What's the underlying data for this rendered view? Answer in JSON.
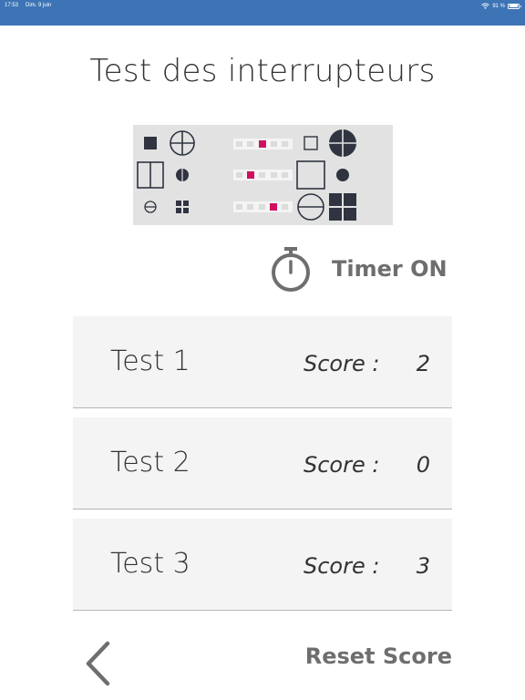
{
  "status_bar": {
    "time": "17:53",
    "date": "Dim. 9 juin",
    "battery": "91 %",
    "wifi_icon": "wifi-icon",
    "background_color": "#3d74b5"
  },
  "page": {
    "title": "Test des interrupteurs"
  },
  "illustration": {
    "description_icon": "switch-test-illustration",
    "background_color": "#e2e2e2",
    "accent_color": "#d0105f"
  },
  "timer": {
    "icon": "stopwatch-icon",
    "label": "Timer ON"
  },
  "tests": [
    {
      "name": "Test 1",
      "score_label": "Score :",
      "score": "2"
    },
    {
      "name": "Test 2",
      "score_label": "Score :",
      "score": "0"
    },
    {
      "name": "Test 3",
      "score_label": "Score :",
      "score": "3"
    }
  ],
  "footer": {
    "back_icon": "chevron-left-icon",
    "reset_label": "Reset Score"
  },
  "colors": {
    "text_dark": "#333333",
    "text_gray": "#6e6e6e",
    "row_background": "#f4f4f4",
    "row_divider": "#b5b5b5"
  }
}
